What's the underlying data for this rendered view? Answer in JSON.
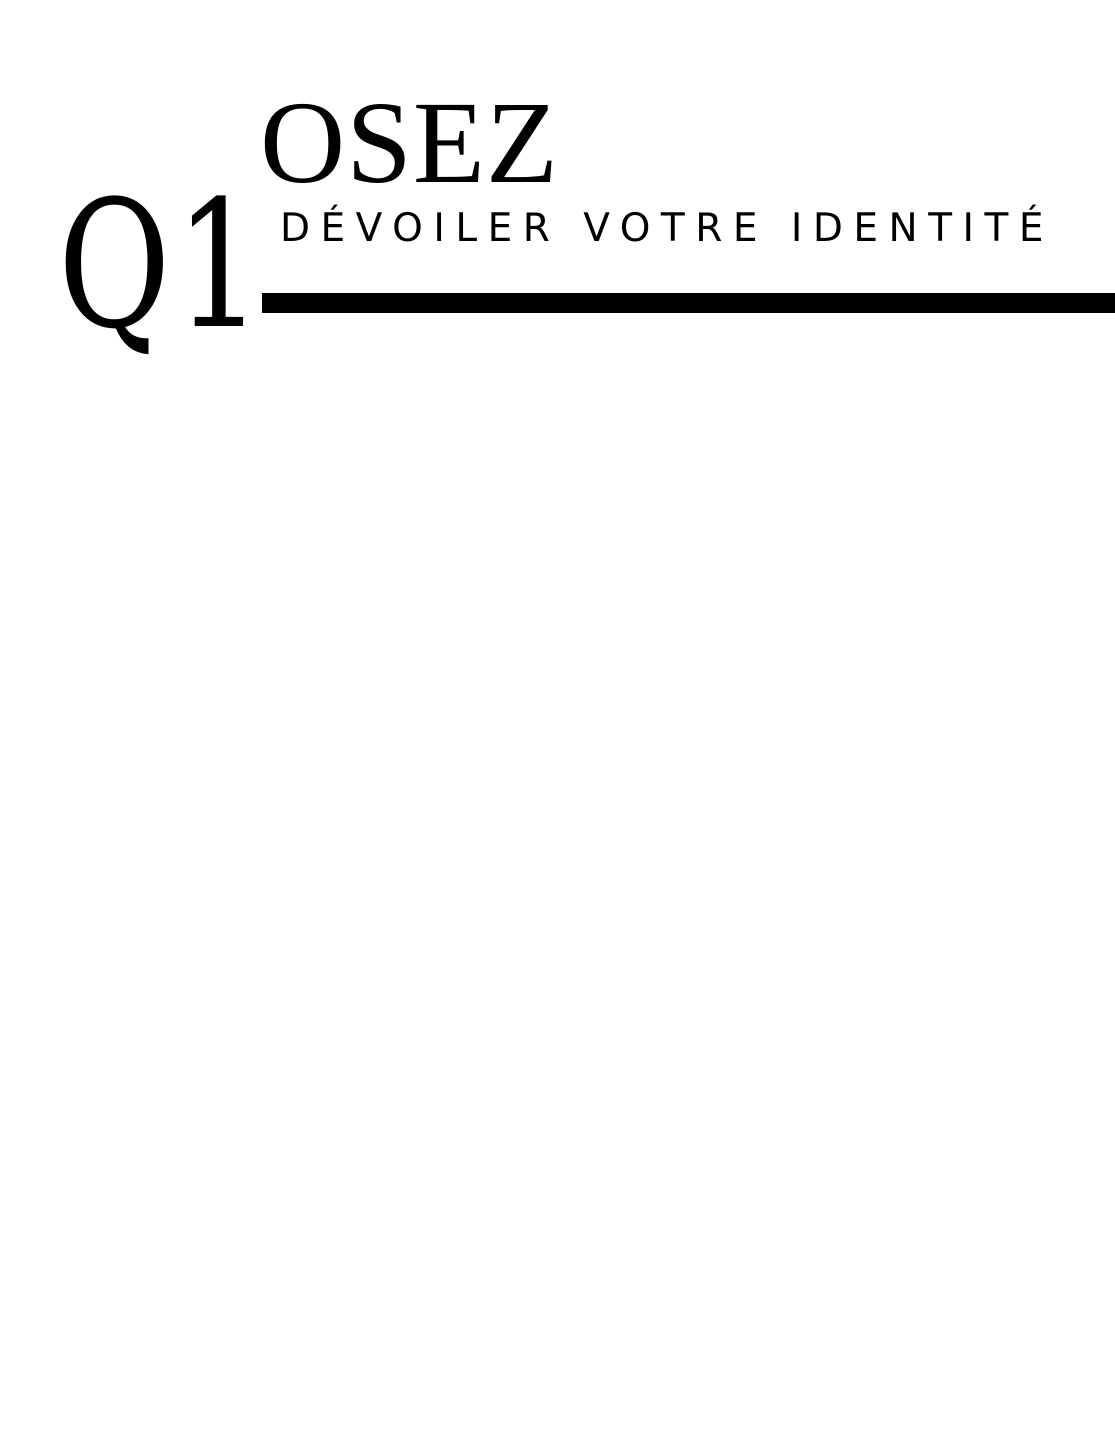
{
  "heading": {
    "number": "Q1",
    "title": "OSEZ",
    "subtitle": "DÉVOILER VOTRE IDENTITÉ"
  },
  "colors": {
    "text": "#000000",
    "background": "#ffffff",
    "rule": "#000000"
  }
}
